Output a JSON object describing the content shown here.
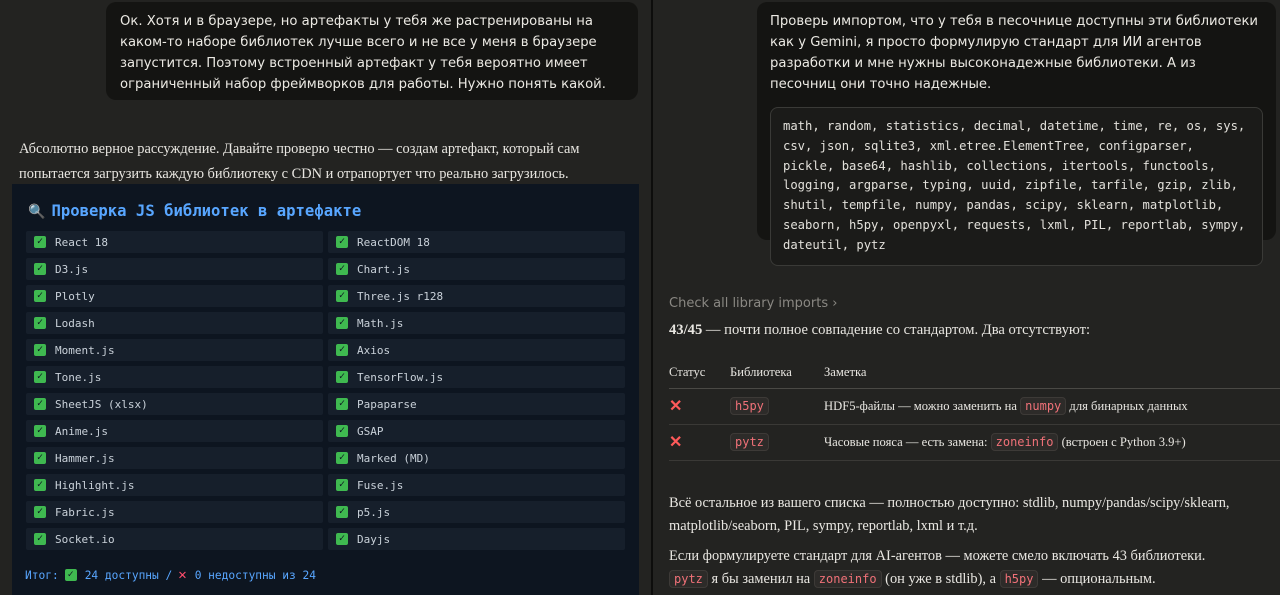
{
  "left_panel": {
    "user_message": "Ок. Хотя и в браузере, но артефакты у тебя же растренированы на каком-то наборе библиотек лучше всего и не все у меня в браузере запустится. Поэтому встроенный артефакт у тебя вероятно имеет ограниченный набор фреймворков для работы. Нужно понять какой.",
    "assistant_reply": "Абсолютно верное рассуждение. Давайте проверю честно — создам артефакт, который сам попытается загрузить каждую библиотеку с CDN и отрапортует что реально загрузилось.",
    "artifact": {
      "title": "Проверка JS библиотек в артефакте",
      "title_icon": "magnifier-icon",
      "libraries": [
        "React 18",
        "ReactDOM 18",
        "D3.js",
        "Chart.js",
        "Plotly",
        "Three.js r128",
        "Lodash",
        "Math.js",
        "Moment.js",
        "Axios",
        "Tone.js",
        "TensorFlow.js",
        "SheetJS (xlsx)",
        "Papaparse",
        "Anime.js",
        "GSAP",
        "Hammer.js",
        "Marked (MD)",
        "Highlight.js",
        "Fuse.js",
        "Fabric.js",
        "p5.js",
        "Socket.io",
        "Dayjs"
      ],
      "summary_prefix": "Итог:",
      "summary_available": "24 доступны /",
      "summary_unavailable": "0 недоступны из 24",
      "colors": {
        "background": "#0d1520",
        "accent": "#58a6ff",
        "ok": "#3fb950",
        "fail": "#ff4d6d"
      }
    }
  },
  "right_panel": {
    "user_message": "Проверь импортом, что у тебя в песочнице доступны эти библиотеки как у Gemini, я просто формулирую стандарт для ИИ агентов разработки и мне нужны высоконадежные библиотеки. А из песочниц они точно надежные.",
    "code_list": "math, random, statistics, decimal, datetime, time, re, os, sys, csv, json, sqlite3, xml.etree.ElementTree, configparser, pickle, base64, hashlib, collections, itertools, functools, logging, argparse, typing, uuid, zipfile, tarfile, gzip, zlib, shutil, tempfile, numpy, pandas, scipy, sklearn, matplotlib, seaborn, h5py, openpyxl, requests, lxml, PIL, reportlab, sympy, dateutil, pytz",
    "check_link": "Check all library imports",
    "heading_bold": "43/45",
    "heading_rest": " — почти полное совпадение со стандартом. Два отсутствуют:",
    "table": {
      "headers": [
        "Статус",
        "Библиотека",
        "Заметка"
      ],
      "rows": [
        {
          "status_icon": "cross-icon",
          "lib": "h5py",
          "note_before": "HDF5-файлы — можно заменить на",
          "note_code": "numpy",
          "note_after": "для бинарных данных"
        },
        {
          "status_icon": "cross-icon",
          "lib": "pytz",
          "note_before": "Часовые пояса — есть замена:",
          "note_code": "zoneinfo",
          "note_after": "(встроен с Python 3.9+)"
        }
      ]
    },
    "para1": "Всё остальное из вашего списка — полностью доступно: stdlib, numpy/pandas/scipy/sklearn, matplotlib/seaborn, PIL, sympy, reportlab, lxml и т.д.",
    "para2_text": "Если формулируете стандарт для AI-агентов — можете смело включать 43 библиотеки.",
    "para2_code1": "pytz",
    "para2_mid1": "я бы заменил на",
    "para2_code2": "zoneinfo",
    "para2_mid2": "(он уже в stdlib), а",
    "para2_code3": "h5py",
    "para2_end": "— опциональным."
  }
}
